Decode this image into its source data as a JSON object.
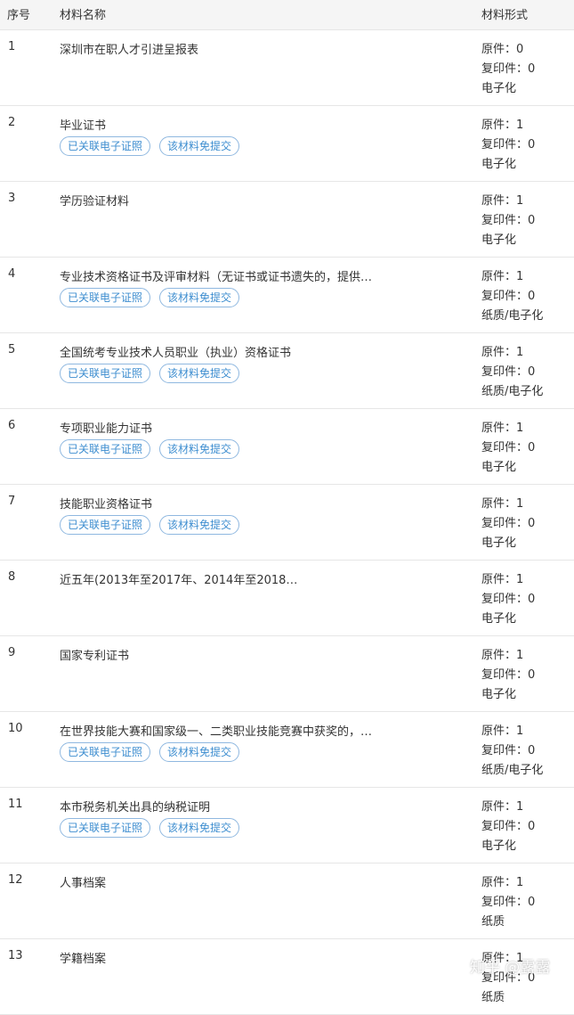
{
  "header": {
    "index": "序号",
    "name": "材料名称",
    "form": "材料形式"
  },
  "tags": {
    "linked": "已关联电子证照",
    "exempt": "该材料免提交"
  },
  "rows": [
    {
      "index": "1",
      "name": "深圳市在职人才引进呈报表",
      "has_tags": false,
      "original": "原件：0",
      "copy": "复印件：0",
      "type": "电子化"
    },
    {
      "index": "2",
      "name": "毕业证书",
      "has_tags": true,
      "original": "原件：1",
      "copy": "复印件：0",
      "type": "电子化"
    },
    {
      "index": "3",
      "name": "学历验证材料",
      "has_tags": false,
      "original": "原件：1",
      "copy": "复印件：0",
      "type": "电子化"
    },
    {
      "index": "4",
      "name": "专业技术资格证书及评审材料（无证书或证书遗失的，提供…",
      "has_tags": true,
      "original": "原件：1",
      "copy": "复印件：0",
      "type": "纸质/电子化"
    },
    {
      "index": "5",
      "name": "全国统考专业技术人员职业（执业）资格证书",
      "has_tags": true,
      "original": "原件：1",
      "copy": "复印件：0",
      "type": "纸质/电子化"
    },
    {
      "index": "6",
      "name": "专项职业能力证书",
      "has_tags": true,
      "original": "原件：1",
      "copy": "复印件：0",
      "type": "电子化"
    },
    {
      "index": "7",
      "name": "技能职业资格证书",
      "has_tags": true,
      "original": "原件：1",
      "copy": "复印件：0",
      "type": "电子化"
    },
    {
      "index": "8",
      "name": "近五年(2013年至2017年、2014年至2018…",
      "has_tags": false,
      "original": "原件：1",
      "copy": "复印件：0",
      "type": "电子化"
    },
    {
      "index": "9",
      "name": "国家专利证书",
      "has_tags": false,
      "original": "原件：1",
      "copy": "复印件：0",
      "type": "电子化"
    },
    {
      "index": "10",
      "name": "在世界技能大赛和国家级一、二类职业技能竞赛中获奖的，…",
      "has_tags": true,
      "original": "原件：1",
      "copy": "复印件：0",
      "type": "纸质/电子化"
    },
    {
      "index": "11",
      "name": "本市税务机关出具的纳税证明",
      "has_tags": true,
      "original": "原件：1",
      "copy": "复印件：0",
      "type": "电子化"
    },
    {
      "index": "12",
      "name": "人事档案",
      "has_tags": false,
      "original": "原件：1",
      "copy": "复印件：0",
      "type": "纸质"
    },
    {
      "index": "13",
      "name": "学籍档案",
      "has_tags": false,
      "original": "原件：1",
      "copy": "复印件：0",
      "type": "纸质"
    }
  ],
  "watermark": "知乎 @露露"
}
